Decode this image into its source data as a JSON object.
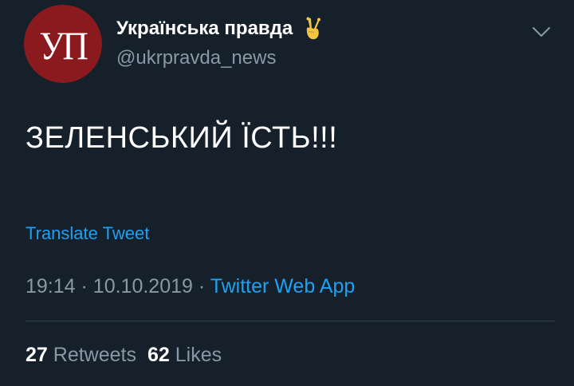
{
  "account": {
    "avatar_text": "УП",
    "display_name": "Українська правда",
    "handle": "@ukrpravda_news",
    "name_emoji": "victory-hand-icon",
    "avatar_color": "#8b1a1e"
  },
  "tweet": {
    "text": "ЗЕЛЕНСЬКИЙ ЇСТЬ!!!",
    "translate_label": "Translate Tweet",
    "time": "19:14",
    "date": "10.10.2019",
    "separator": "·",
    "source": "Twitter Web App"
  },
  "stats": {
    "retweets_count": "27",
    "retweets_label": "Retweets",
    "likes_count": "62",
    "likes_label": "Likes"
  },
  "colors": {
    "background": "#15202b",
    "link": "#1da1f2",
    "secondary_text": "#8899a6",
    "divider": "#38444d"
  }
}
